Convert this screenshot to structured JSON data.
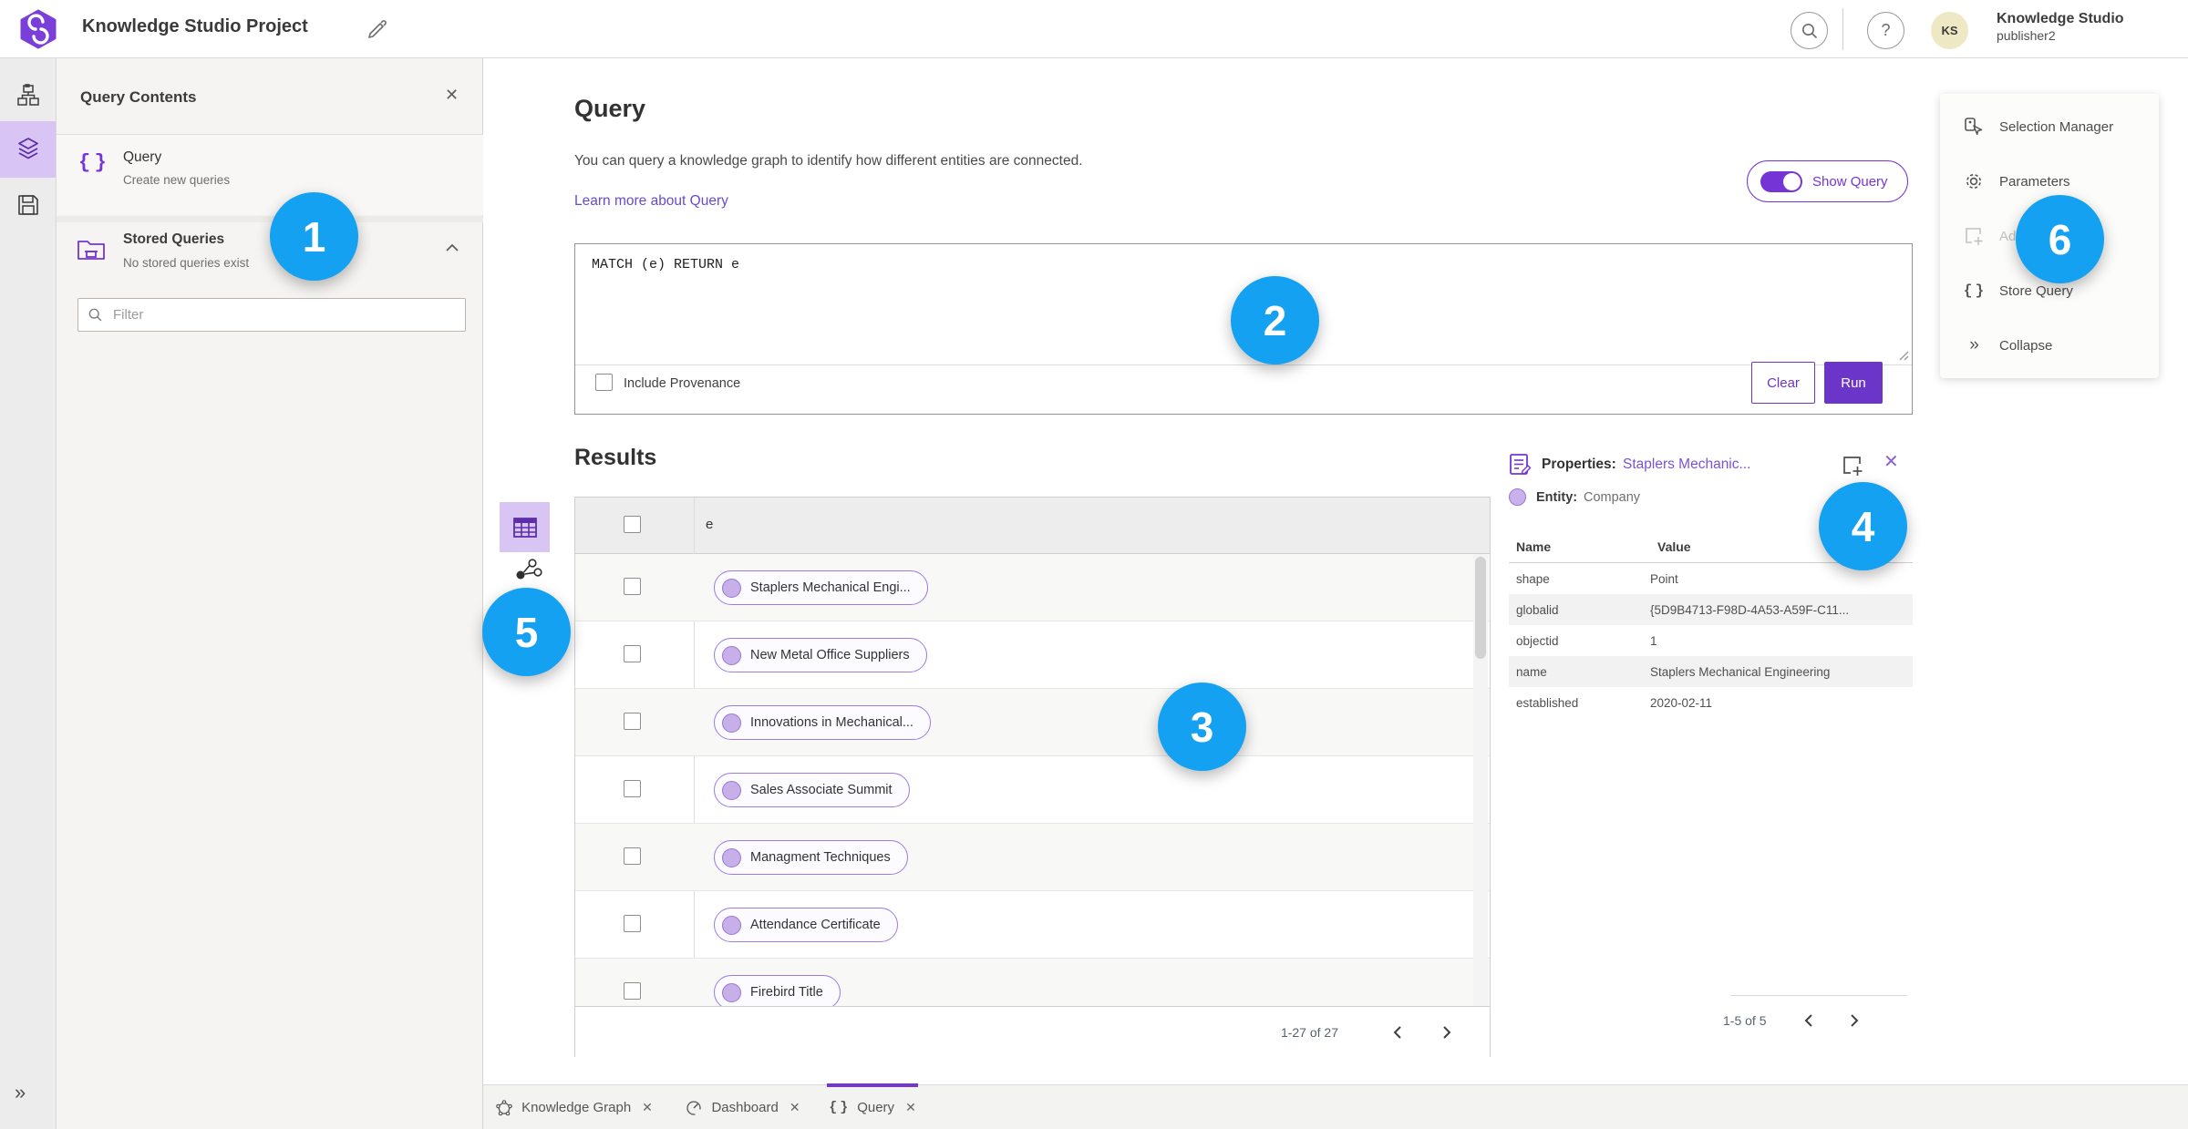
{
  "header": {
    "app_title": "Knowledge Studio Project",
    "user": {
      "initials": "KS",
      "name": "Knowledge Studio",
      "role": "publisher2"
    }
  },
  "query_contents": {
    "title": "Query Contents",
    "query_item": {
      "label": "Query",
      "description": "Create new queries"
    },
    "stored_item": {
      "label": "Stored Queries",
      "description": "No stored queries exist"
    },
    "filter_placeholder": "Filter"
  },
  "query_panel": {
    "title": "Query",
    "description": "You can query a knowledge graph to identify how different entities are connected.",
    "learn_more": "Learn more about Query",
    "show_query_label": "Show Query",
    "query_text": "MATCH (e) RETURN e",
    "include_provenance_label": "Include Provenance",
    "clear_label": "Clear",
    "run_label": "Run"
  },
  "results": {
    "title": "Results",
    "column_header": "e",
    "rows": [
      "Staplers Mechanical Engi...",
      "New Metal Office Suppliers",
      "Innovations in Mechanical...",
      "Sales Associate Summit",
      "Managment Techniques",
      "Attendance Certificate",
      "Firebird Title"
    ],
    "pagination": {
      "range": "1-27 of 27"
    }
  },
  "properties": {
    "title": "Properties:",
    "entity_link": "Staplers Mechanic...",
    "entity_label": "Entity:",
    "entity_type": "Company",
    "name_header": "Name",
    "value_header": "Value",
    "rows": [
      {
        "name": "shape",
        "value": "Point"
      },
      {
        "name": "globalid",
        "value": "{5D9B4713-F98D-4A53-A59F-C11..."
      },
      {
        "name": "objectid",
        "value": "1"
      },
      {
        "name": "name",
        "value": "Staplers Mechanical Engineering"
      },
      {
        "name": "established",
        "value": "2020-02-11"
      }
    ],
    "pagination": {
      "range": "1-5 of 5"
    }
  },
  "right_menu": {
    "items": [
      {
        "label": "Selection Manager"
      },
      {
        "label": "Parameters"
      },
      {
        "label": "Add To Selection"
      },
      {
        "label": "Store Query"
      },
      {
        "label": "Collapse"
      }
    ]
  },
  "tabs": [
    {
      "label": "Knowledge Graph"
    },
    {
      "label": "Dashboard"
    },
    {
      "label": "Query"
    }
  ],
  "annotations": {
    "badges": [
      "1",
      "2",
      "3",
      "4",
      "5",
      "6"
    ]
  },
  "colors": {
    "accent_purple": "#6C35C9",
    "toggle_purple": "#7434D6",
    "badge_blue": "#14A1F1",
    "link_purple": "#6A49CF",
    "entity_fill": "#C9B2EC",
    "entity_border": "#9878D2"
  }
}
